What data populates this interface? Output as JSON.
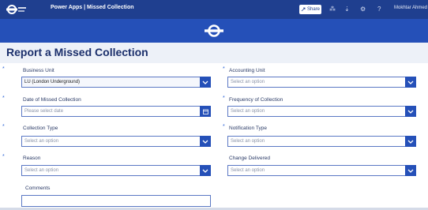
{
  "topbar": {
    "app_title": "Power Apps  |  Missed Collection",
    "share_label": "Share",
    "user_name": "Mokhtar Ahmed"
  },
  "page": {
    "title": "Report a Missed Collection"
  },
  "form": {
    "business_unit": {
      "label": "Business Unit",
      "value": "LU (London Underground)"
    },
    "accounting_unit": {
      "label": "Accounting Unit",
      "placeholder": "Select an option"
    },
    "date_missed": {
      "label": "Date of Missed Collection",
      "placeholder": "Please select date"
    },
    "frequency": {
      "label": "Frequency of Collection",
      "placeholder": "Select an option"
    },
    "collection_type": {
      "label": "Collection Type",
      "placeholder": "Select an option"
    },
    "notification_type": {
      "label": "Notification Type",
      "placeholder": "Select an option"
    },
    "reason": {
      "label": "Reason",
      "placeholder": "Select an option"
    },
    "change_delivered": {
      "label": "Change Delivered",
      "placeholder": "Select an option"
    },
    "comments": {
      "label": "Comments",
      "value": ""
    }
  },
  "colors": {
    "topbar": "#1f3f8f",
    "banner": "#2550b8",
    "accent": "#2a63d6",
    "title": "#1b2f6b"
  },
  "icons": [
    "tfl-logo-icon",
    "share-icon",
    "grid-icon",
    "download-icon",
    "settings-icon",
    "help-icon",
    "tfl-roundel-icon",
    "chevron-down-icon",
    "calendar-icon"
  ]
}
